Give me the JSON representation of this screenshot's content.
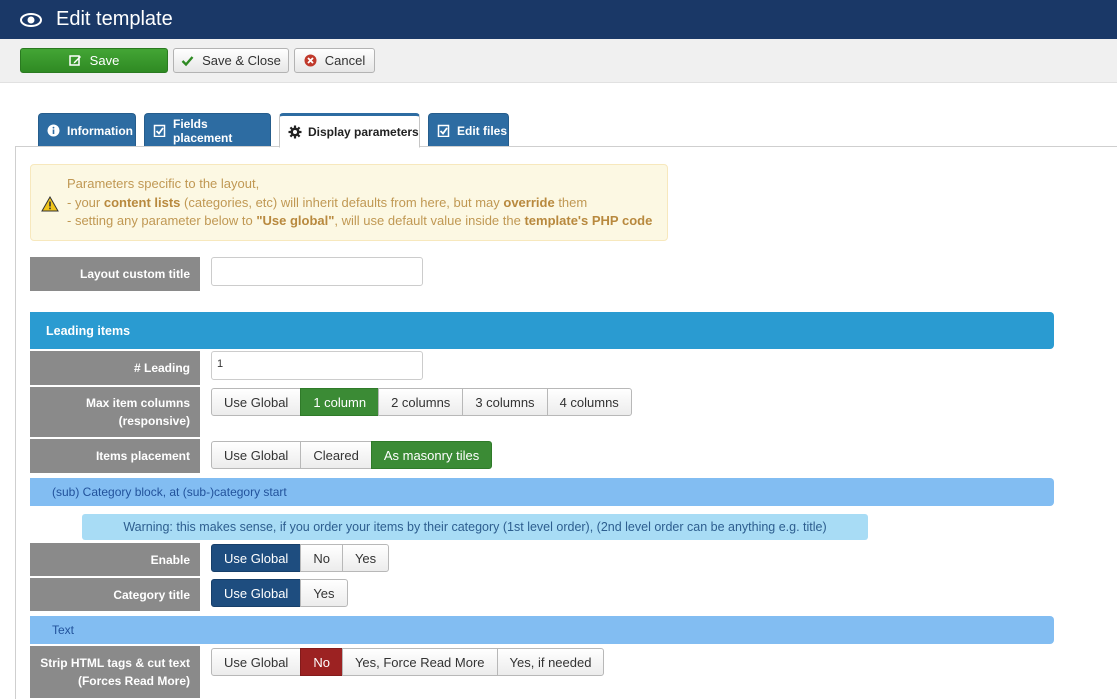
{
  "header": {
    "title": "Edit template",
    "icon": "eye-icon"
  },
  "toolbar": {
    "save": "Save",
    "save_close": "Save & Close",
    "cancel": "Cancel"
  },
  "tabs": [
    {
      "label": "Information",
      "icon": "info-icon"
    },
    {
      "label": "Fields placement",
      "icon": "clipboard-check-icon"
    },
    {
      "label": "Display parameters",
      "icon": "gear-icon",
      "active": true
    },
    {
      "label": "Edit files",
      "icon": "clipboard-check-icon"
    }
  ],
  "alert": {
    "line1": "Parameters specific to the layout,",
    "line2_a": "- your ",
    "line2_b": "content lists",
    "line2_c": " (categories, etc) will inherit defaults from here, but may ",
    "line2_d": "override",
    "line2_e": " them",
    "line3_a": "- setting any parameter below to ",
    "line3_b": "\"Use global\"",
    "line3_c": ", will use default value inside the ",
    "line3_d": "template's PHP code"
  },
  "layout_custom_title": {
    "label": "Layout custom title",
    "value": ""
  },
  "sections": {
    "leading": "Leading items",
    "subcat": "(sub) Category block, at (sub-)category start",
    "text": "Text"
  },
  "leading": {
    "label": "# Leading",
    "value": "1",
    "max_cols_label_1": "Max item columns",
    "max_cols_label_2": "(responsive)",
    "max_cols_options": [
      "Use Global",
      "1 column",
      "2 columns",
      "3 columns",
      "4 columns"
    ],
    "max_cols_selected": "1 column",
    "placement_label": "Items placement",
    "placement_options": [
      "Use Global",
      "Cleared",
      "As masonry tiles"
    ],
    "placement_selected": "As masonry tiles"
  },
  "warning": "Warning: this makes sense, if you order your items by their category (1st level order), (2nd level order can be anything e.g. title)",
  "enable": {
    "label": "Enable",
    "options": [
      "Use Global",
      "No",
      "Yes"
    ],
    "selected": "Use Global"
  },
  "category_title": {
    "label": "Category title",
    "options": [
      "Use Global",
      "Yes"
    ],
    "selected": "Use Global"
  },
  "strip_html": {
    "label_1": "Strip HTML tags & cut text",
    "label_2": "(Forces Read More)",
    "options": [
      "Use Global",
      "No",
      "Yes, Force Read More",
      "Yes, if needed"
    ],
    "selected": "No"
  },
  "colors": {
    "header_bg": "#1a3867",
    "section_blue": "#2a9bd1",
    "subsection_blue": "#82bdf2",
    "selected_green": "#3b8b35",
    "selected_navy": "#1e4d7f",
    "selected_red": "#9c2222"
  }
}
